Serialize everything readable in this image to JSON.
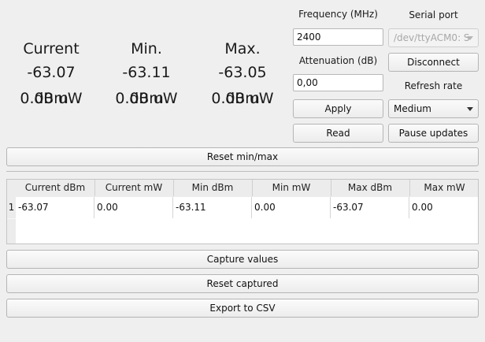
{
  "readouts": [
    {
      "header": "Current",
      "dbm": "-63.07 dBm",
      "uw": "0.00 uW"
    },
    {
      "header": "Min.",
      "dbm": "-63.11 dBm",
      "uw": "0.00 uW"
    },
    {
      "header": "Max.",
      "dbm": "-63.05 dBm",
      "uw": "0.00 uW"
    }
  ],
  "controls": {
    "frequency_label": "Frequency (MHz)",
    "frequency_value": "2400",
    "attenuation_label": "Attenuation (dB)",
    "attenuation_value": "0,00",
    "apply_label": "Apply",
    "read_label": "Read",
    "serial_port_label": "Serial port",
    "serial_port_value": "/dev/ttyACM0: S",
    "disconnect_label": "Disconnect",
    "refresh_rate_label": "Refresh rate",
    "refresh_rate_value": "Medium",
    "pause_label": "Pause updates"
  },
  "reset_minmax_label": "Reset min/max",
  "table": {
    "columns": [
      "Current dBm",
      "Current mW",
      "Min dBm",
      "Min mW",
      "Max dBm",
      "Max mW"
    ],
    "rows": [
      {
        "index": "1",
        "cells": [
          "-63.07",
          "0.00",
          "-63.11",
          "0.00",
          "-63.07",
          "0.00"
        ]
      }
    ]
  },
  "actions": {
    "capture_label": "Capture values",
    "reset_captured_label": "Reset captured",
    "export_label": "Export to CSV"
  }
}
